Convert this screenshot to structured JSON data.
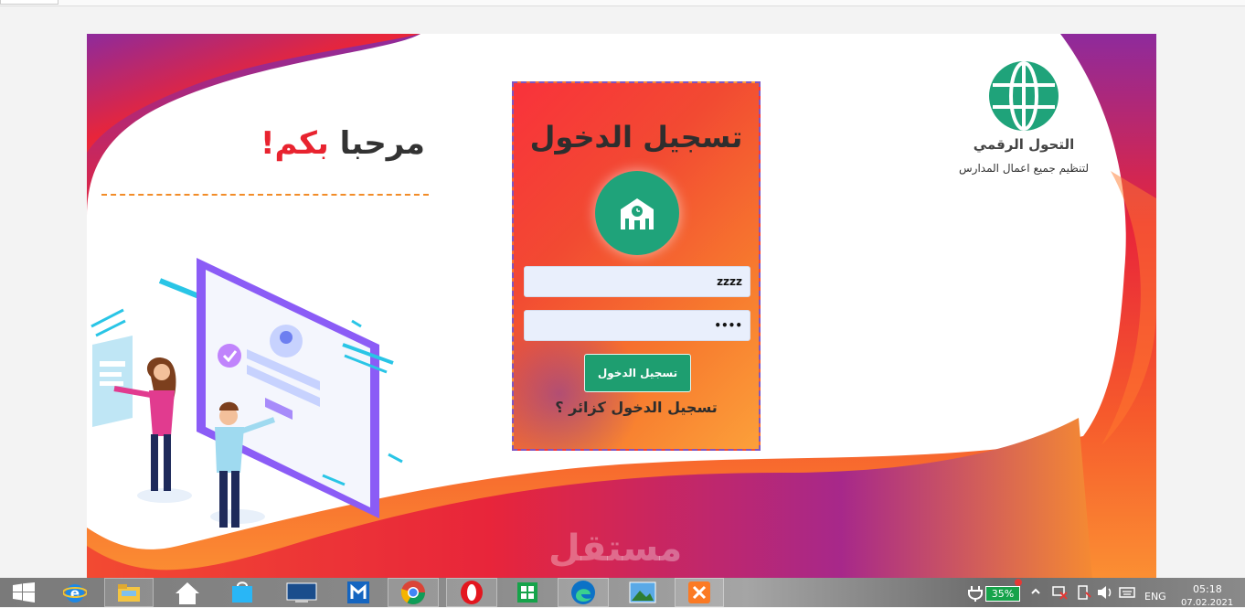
{
  "brand": {
    "name": "التحول الرقمي",
    "tagline": "لتنظيم جميع اعمال المدارس"
  },
  "welcome": {
    "word1": "مرحبا",
    "word2": "بكم",
    "exclaim": "!"
  },
  "login": {
    "title": "تسجيل الدخول",
    "username_value": "zzzz",
    "password_value": "••••",
    "submit_label": "تسجيل الدخول",
    "guest_link": "تسجيل الدخول كزائر ؟"
  },
  "watermark": "مستقل",
  "taskbar": {
    "apps": [
      "start-icon",
      "ie-icon",
      "file-explorer-icon",
      "home-icon",
      "store-icon",
      "lenovo-icon",
      "maxthon-icon",
      "chrome-icon",
      "opera-icon",
      "office-icon",
      "edge-icon",
      "photos-icon",
      "xampp-icon"
    ],
    "battery_percent": "35%",
    "language": "ENG",
    "time": "05:18",
    "date": "07.02.2021"
  },
  "colors": {
    "accent_green": "#1fa37a",
    "gradient_red": "#f9323b",
    "gradient_orange": "#fca03a",
    "purple": "#8e2a9c"
  }
}
